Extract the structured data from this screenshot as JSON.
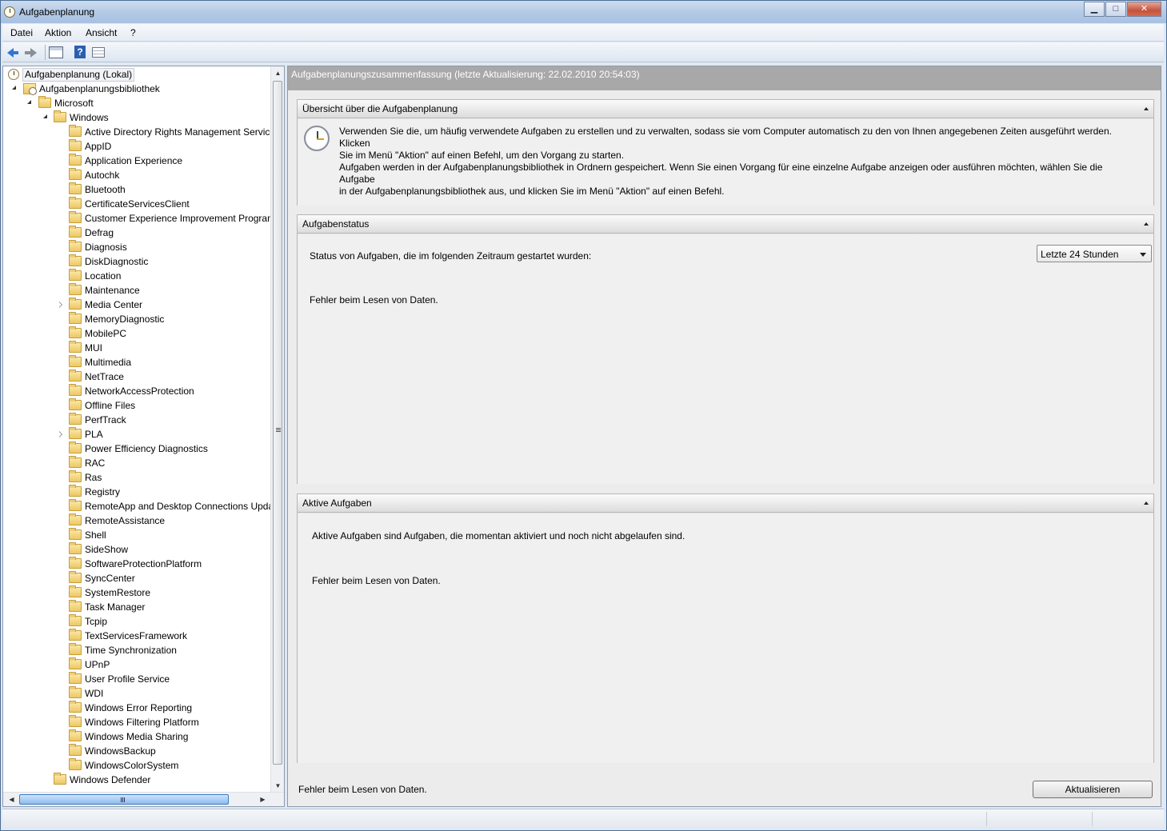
{
  "window": {
    "title": "Aufgabenplanung",
    "buttons": {
      "minimize": "▁",
      "maximize": "□",
      "close": "✕"
    }
  },
  "menu": {
    "items": [
      "Datei",
      "Aktion",
      "Ansicht",
      "?"
    ]
  },
  "toolbar": {
    "icons": [
      "back-icon",
      "forward-icon",
      "console-tree-icon",
      "help-icon",
      "view-icon"
    ]
  },
  "tree": {
    "root": "Aufgabenplanung (Lokal)",
    "library": "Aufgabenplanungsbibliothek",
    "microsoft": "Microsoft",
    "windows": "Windows",
    "windows_children": [
      "Active Directory Rights Management Services",
      "AppID",
      "Application Experience",
      "Autochk",
      "Bluetooth",
      "CertificateServicesClient",
      "Customer Experience Improvement Program",
      "Defrag",
      "Diagnosis",
      "DiskDiagnostic",
      "Location",
      "Maintenance",
      "Media Center",
      "MemoryDiagnostic",
      "MobilePC",
      "MUI",
      "Multimedia",
      "NetTrace",
      "NetworkAccessProtection",
      "Offline Files",
      "PerfTrack",
      "PLA",
      "Power Efficiency Diagnostics",
      "RAC",
      "Ras",
      "Registry",
      "RemoteApp and Desktop Connections Update",
      "RemoteAssistance",
      "Shell",
      "SideShow",
      "SoftwareProtectionPlatform",
      "SyncCenter",
      "SystemRestore",
      "Task Manager",
      "Tcpip",
      "TextServicesFramework",
      "Time Synchronization",
      "UPnP",
      "User Profile Service",
      "WDI",
      "Windows Error Reporting",
      "Windows Filtering Platform",
      "Windows Media Sharing",
      "WindowsBackup",
      "WindowsColorSystem"
    ],
    "collapsed_children": [
      "Media Center",
      "PLA"
    ],
    "sibling": "Windows Defender"
  },
  "content": {
    "header": "Aufgabenplanungszusammenfassung (letzte Aktualisierung: 22.02.2010 20:54:03)",
    "overview": {
      "title": "Übersicht über die Aufgabenplanung",
      "p1_line1": "Verwenden Sie die, um häufig verwendete Aufgaben zu erstellen und zu verwalten, sodass sie vom Computer automatisch zu den von Ihnen angegebenen Zeiten ausgeführt werden. Klicken",
      "p1_line2": "Sie im Menü \"Aktion\" auf einen Befehl, um den Vorgang zu starten.",
      "p2_line1": "Aufgaben werden in der Aufgabenplanungsbibliothek in Ordnern gespeichert. Wenn Sie einen Vorgang für eine einzelne Aufgabe anzeigen oder ausführen möchten, wählen Sie die Aufgabe",
      "p2_line2": "in der Aufgabenplanungsbibliothek aus, und klicken Sie im Menü \"Aktion\" auf einen Befehl."
    },
    "status": {
      "title": "Aufgabenstatus",
      "label": "Status von Aufgaben, die im folgenden Zeitraum gestartet wurden:",
      "period": "Letzte 24 Stunden",
      "error": "Fehler beim Lesen von Daten."
    },
    "active": {
      "title": "Aktive Aufgaben",
      "desc": "Aktive Aufgaben sind Aufgaben, die momentan aktiviert und noch nicht abgelaufen sind.",
      "error": "Fehler beim Lesen von Daten."
    },
    "footer": {
      "error": "Fehler beim Lesen von Daten.",
      "refresh": "Aktualisieren"
    }
  }
}
